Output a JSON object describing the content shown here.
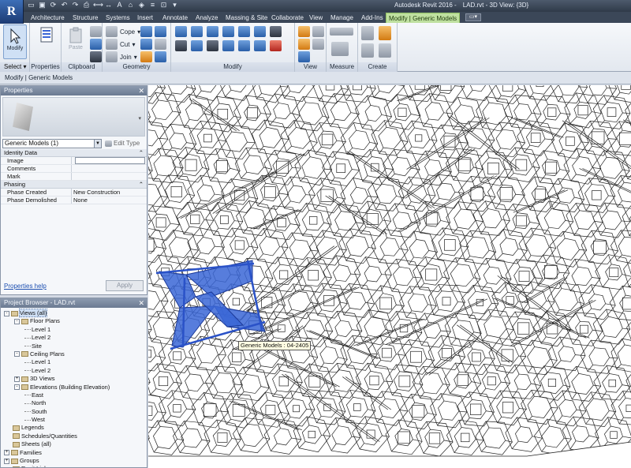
{
  "app": {
    "logo": "R",
    "title": "Autodesk Revit 2016 -",
    "document": "LAD.rvt - 3D View: {3D}"
  },
  "qat_icons": [
    "open-icon",
    "save-icon",
    "sync-icon",
    "undo-icon",
    "redo-icon",
    "print-icon",
    "measure-icon",
    "dimension-icon",
    "text-icon",
    "view3d-icon",
    "section-icon",
    "thin-lines-icon",
    "close-hidden-icon",
    "switch-window-icon"
  ],
  "tabs": [
    "Architecture",
    "Structure",
    "Systems",
    "Insert",
    "Annotate",
    "Analyze",
    "Massing & Site",
    "Collaborate",
    "View",
    "Manage",
    "Add-Ins",
    "Modify | Generic Models"
  ],
  "active_tab": "Modify | Generic Models",
  "ribbon": {
    "select_label": "Select",
    "modify_label": "Modify",
    "panels": {
      "properties": "Properties",
      "clipboard": "Clipboard",
      "geometry": "Geometry",
      "modify": "Modify",
      "view": "View",
      "measure": "Measure",
      "create": "Create"
    },
    "clipboard": {
      "paste": "Paste"
    },
    "geometry": {
      "cope": "Cope",
      "cut": "Cut",
      "join": "Join"
    }
  },
  "context_bar": "Modify | Generic Models",
  "properties": {
    "title": "Properties",
    "type_selector": "Generic Models (1)",
    "edit_type": "Edit Type",
    "groups": [
      {
        "name": "Identity Data",
        "rows": [
          {
            "k": "Image",
            "v": ""
          },
          {
            "k": "Comments",
            "v": ""
          },
          {
            "k": "Mark",
            "v": ""
          }
        ]
      },
      {
        "name": "Phasing",
        "rows": [
          {
            "k": "Phase Created",
            "v": "New Construction"
          },
          {
            "k": "Phase Demolished",
            "v": "None"
          }
        ]
      }
    ],
    "help_link": "Properties help",
    "apply": "Apply"
  },
  "project_browser": {
    "title": "Project Browser - LAD.rvt",
    "tree": [
      {
        "label": "Views (all)",
        "level": 0,
        "exp": "-",
        "sel": true
      },
      {
        "label": "Floor Plans",
        "level": 1,
        "exp": "-"
      },
      {
        "label": "Level 1",
        "level": 2
      },
      {
        "label": "Level 2",
        "level": 2
      },
      {
        "label": "Site",
        "level": 2
      },
      {
        "label": "Ceiling Plans",
        "level": 1,
        "exp": "-"
      },
      {
        "label": "Level 1",
        "level": 2
      },
      {
        "label": "Level 2",
        "level": 2
      },
      {
        "label": "3D Views",
        "level": 1,
        "exp": "+"
      },
      {
        "label": "Elevations (Building Elevation)",
        "level": 1,
        "exp": "-"
      },
      {
        "label": "East",
        "level": 2
      },
      {
        "label": "North",
        "level": 2
      },
      {
        "label": "South",
        "level": 2
      },
      {
        "label": "West",
        "level": 2
      },
      {
        "label": "Legends",
        "level": 0
      },
      {
        "label": "Schedules/Quantities",
        "level": 0
      },
      {
        "label": "Sheets (all)",
        "level": 0
      },
      {
        "label": "Families",
        "level": 0,
        "exp": "+"
      },
      {
        "label": "Groups",
        "level": 0,
        "exp": "+"
      },
      {
        "label": "Revit Links",
        "level": 0
      }
    ]
  },
  "viewport": {
    "tooltip": "Generic Models : 04-2405",
    "selection_color": "#3a66d6",
    "line_color": "#222222"
  },
  "colors": {
    "active_tab": "#bfe0a0",
    "title_bar": "#3b4758",
    "link": "#1d4fb0"
  }
}
